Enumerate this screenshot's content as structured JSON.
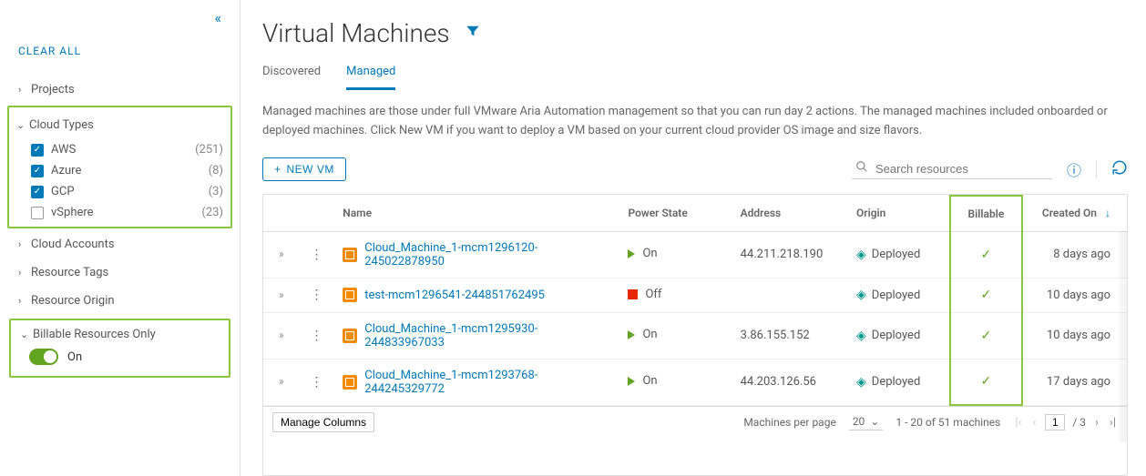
{
  "sidebar": {
    "clear_all": "CLEAR ALL",
    "groups": {
      "projects": "Projects",
      "cloud_types": "Cloud Types",
      "cloud_accounts": "Cloud Accounts",
      "resource_tags": "Resource Tags",
      "resource_origin": "Resource Origin",
      "billable_only": "Billable Resources Only"
    },
    "cloud_type_options": [
      {
        "label": "AWS",
        "count": "(251)",
        "checked": true
      },
      {
        "label": "Azure",
        "count": "(8)",
        "checked": true
      },
      {
        "label": "GCP",
        "count": "(3)",
        "checked": true
      },
      {
        "label": "vSphere",
        "count": "(23)",
        "checked": false
      }
    ],
    "billable_toggle_label": "On"
  },
  "header": {
    "title": "Virtual Machines",
    "tabs": {
      "discovered": "Discovered",
      "managed": "Managed"
    },
    "description": "Managed machines are those under full VMware Aria Automation management so that you can run day 2 actions. The managed machines included onboarded or deployed machines. Click New VM if you want to deploy a VM based on your current cloud provider OS image and size flavors."
  },
  "actions": {
    "new_vm": "NEW VM",
    "search_placeholder": "Search resources"
  },
  "table": {
    "columns": {
      "name": "Name",
      "power": "Power State",
      "address": "Address",
      "origin": "Origin",
      "billable": "Billable",
      "created": "Created On"
    },
    "rows": [
      {
        "name": "Cloud_Machine_1-mcm1296120-245022878950",
        "power_label": "On",
        "power": "on",
        "address": "44.211.218.190",
        "origin": "Deployed",
        "billable": true,
        "created": "8 days ago"
      },
      {
        "name": "test-mcm1296541-244851762495",
        "power_label": "Off",
        "power": "off",
        "address": "",
        "origin": "Deployed",
        "billable": true,
        "created": "10 days ago"
      },
      {
        "name": "Cloud_Machine_1-mcm1295930-244833967033",
        "power_label": "On",
        "power": "on",
        "address": "3.86.155.152",
        "origin": "Deployed",
        "billable": true,
        "created": "10 days ago"
      },
      {
        "name": "Cloud_Machine_1-mcm1293768-244245329772",
        "power_label": "On",
        "power": "on",
        "address": "44.203.126.56",
        "origin": "Deployed",
        "billable": true,
        "created": "17 days ago"
      }
    ]
  },
  "footer": {
    "manage_columns": "Manage Columns",
    "per_page_label": "Machines per page",
    "per_page_value": "20",
    "range_text": "1 - 20 of 51 machines",
    "current_page": "1",
    "total_pages": "/ 3"
  }
}
